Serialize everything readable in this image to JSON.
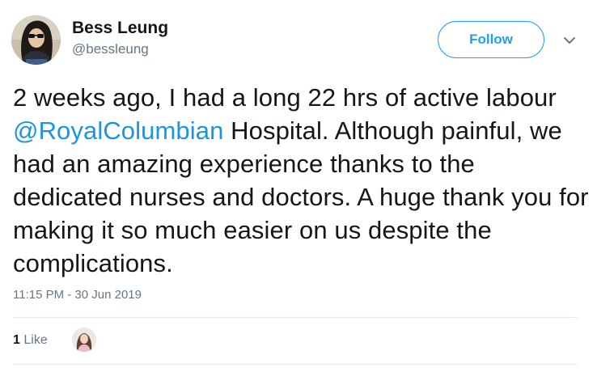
{
  "user": {
    "display_name": "Bess Leung",
    "handle": "@bessleung"
  },
  "follow_button": {
    "label": "Follow"
  },
  "tweet": {
    "text_before": "2 weeks ago, I had a long 22 hrs of active labour ",
    "mention": "@RoyalColumbian",
    "text_after": " Hospital. Although painful, we had an amazing experience thanks to the dedicated nurses and doctors. A huge thank you for making it so much easier on us despite the complications.",
    "timestamp": "11:15 PM - 30 Jun 2019"
  },
  "stats": {
    "like_count": "1",
    "like_label": "Like"
  },
  "colors": {
    "accent": "#1da1f2",
    "mention": "#1b95e0",
    "secondary_text": "#657786",
    "primary_text": "#14171a",
    "divider": "#e6ecf0"
  },
  "icons": {
    "more_menu": "chevron-down-icon"
  }
}
